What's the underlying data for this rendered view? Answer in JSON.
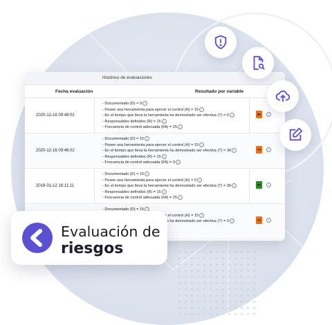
{
  "panel": {
    "title": "Histórico de evaluaciones",
    "col_date": "Fecha evaluación",
    "col_result": "Resultado por variable",
    "rows": [
      {
        "date": "2020-12-16 09:49:02",
        "score": "85",
        "score_color": "#e8711c",
        "lines": [
          "- Documentado (D) = 0",
          "- Posee una herramienta para ejercer el control (H) = 15",
          "- En el tiempo que lleva la herramienta ha demostrado ser efectiva (T) = 0",
          "- Responsables definidos (R) = 15",
          "- Frecuencia de control adecuada (FA) = 25"
        ]
      },
      {
        "date": "2020-12-16 09:46:02",
        "score": "75",
        "score_color": "#e8711c",
        "lines": [
          "- Documentado (D) = 15",
          "- Posee una herramienta para ejercer el control (H) = 15",
          "- En el tiempo que lleva la herramienta ha demostrado ser efectiva (T) = 30",
          "- Responsables definidos (R) = 15",
          "- Frecuencia de control adecuada (FA) = 0"
        ]
      },
      {
        "date": "2018-01-12 16:11:11",
        "score": "85",
        "score_color": "#2f8a2f",
        "lines": [
          "- Documentado (D) = 15",
          "- Posee una herramienta para ejercer el control (H) = 0",
          "- En el tiempo que lleva la herramienta ha demostrado ser efectiva (T) = 30",
          "- Responsables definidos (R) = 15",
          "- Frecuencia de control adecuada (FA) = 25"
        ]
      },
      {
        "date": "",
        "score": "70",
        "score_color": "#e8711c",
        "lines": [
          "- Documentado (D) = 15",
          "- Posee una herramienta para ejercer el control (H) = 15",
          "- En el tiempo que lleva la herramienta ha demostrado ser efectiva (T) = 0",
          "",
          "25"
        ]
      }
    ]
  },
  "icons": [
    "shield-alert-icon",
    "document-search-icon",
    "cloud-upload-icon",
    "edit-icon"
  ],
  "accent": "#5b4fd4",
  "card": {
    "line1": "Evaluación de",
    "line2": "riesgos"
  }
}
